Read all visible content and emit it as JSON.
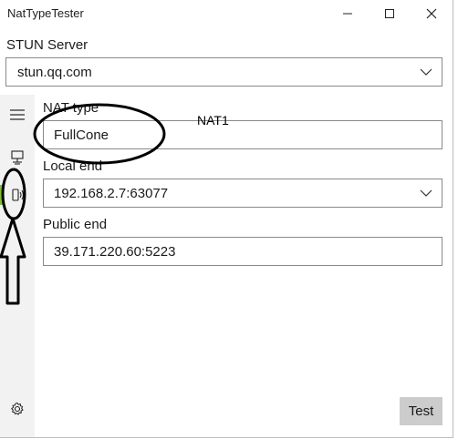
{
  "window": {
    "title": "NatTypeTester"
  },
  "stun": {
    "label": "STUN Server",
    "value": "stun.qq.com"
  },
  "fields": {
    "nat_type": {
      "label": "NAT type",
      "value": "FullCone"
    },
    "local_end": {
      "label": "Local end",
      "value": "192.168.2.7:63077"
    },
    "public_end": {
      "label": "Public end",
      "value": "39.171.220.60:5223"
    }
  },
  "actions": {
    "test_label": "Test"
  },
  "annotation": {
    "text": "NAT1"
  },
  "icons": {
    "menu": "hamburger-menu-icon",
    "page1": "computer-network-icon",
    "page2": "device-speaker-icon",
    "settings": "gear-icon",
    "minimize": "minimize-icon",
    "maximize": "maximize-icon",
    "close": "close-icon"
  },
  "colors": {
    "selected_indicator": "#7cbf3a",
    "button_bg": "#cccccc"
  }
}
